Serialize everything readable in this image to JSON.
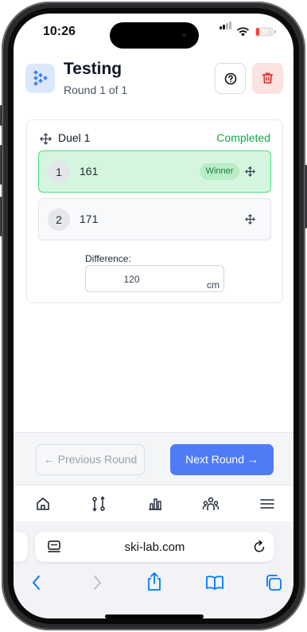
{
  "status_bar": {
    "time": "10:26",
    "battery": "20",
    "battery_level": 0.2
  },
  "header": {
    "title": "Testing",
    "subtitle": "Round 1 of 1"
  },
  "duel": {
    "title": "Duel 1",
    "status": "Completed",
    "entries": [
      {
        "rank": "1",
        "value": "161",
        "badge": "Winner"
      },
      {
        "rank": "2",
        "value": "171"
      }
    ],
    "difference_label": "Difference:",
    "difference_value": "120",
    "difference_unit": "cm"
  },
  "navigation": {
    "prev_label": "← Previous Round",
    "next_label": "Next Round →"
  },
  "tabs": [
    "home-icon",
    "compare-icon",
    "chart-icon",
    "team-icon",
    "menu-icon"
  ],
  "browser": {
    "url": "ski-lab.com"
  },
  "colors": {
    "primary": "#4f7cf6",
    "success": "#16a34a",
    "winner_bg": "#d6f5df",
    "danger": "#dc2626",
    "ios_blue": "#007aff"
  }
}
